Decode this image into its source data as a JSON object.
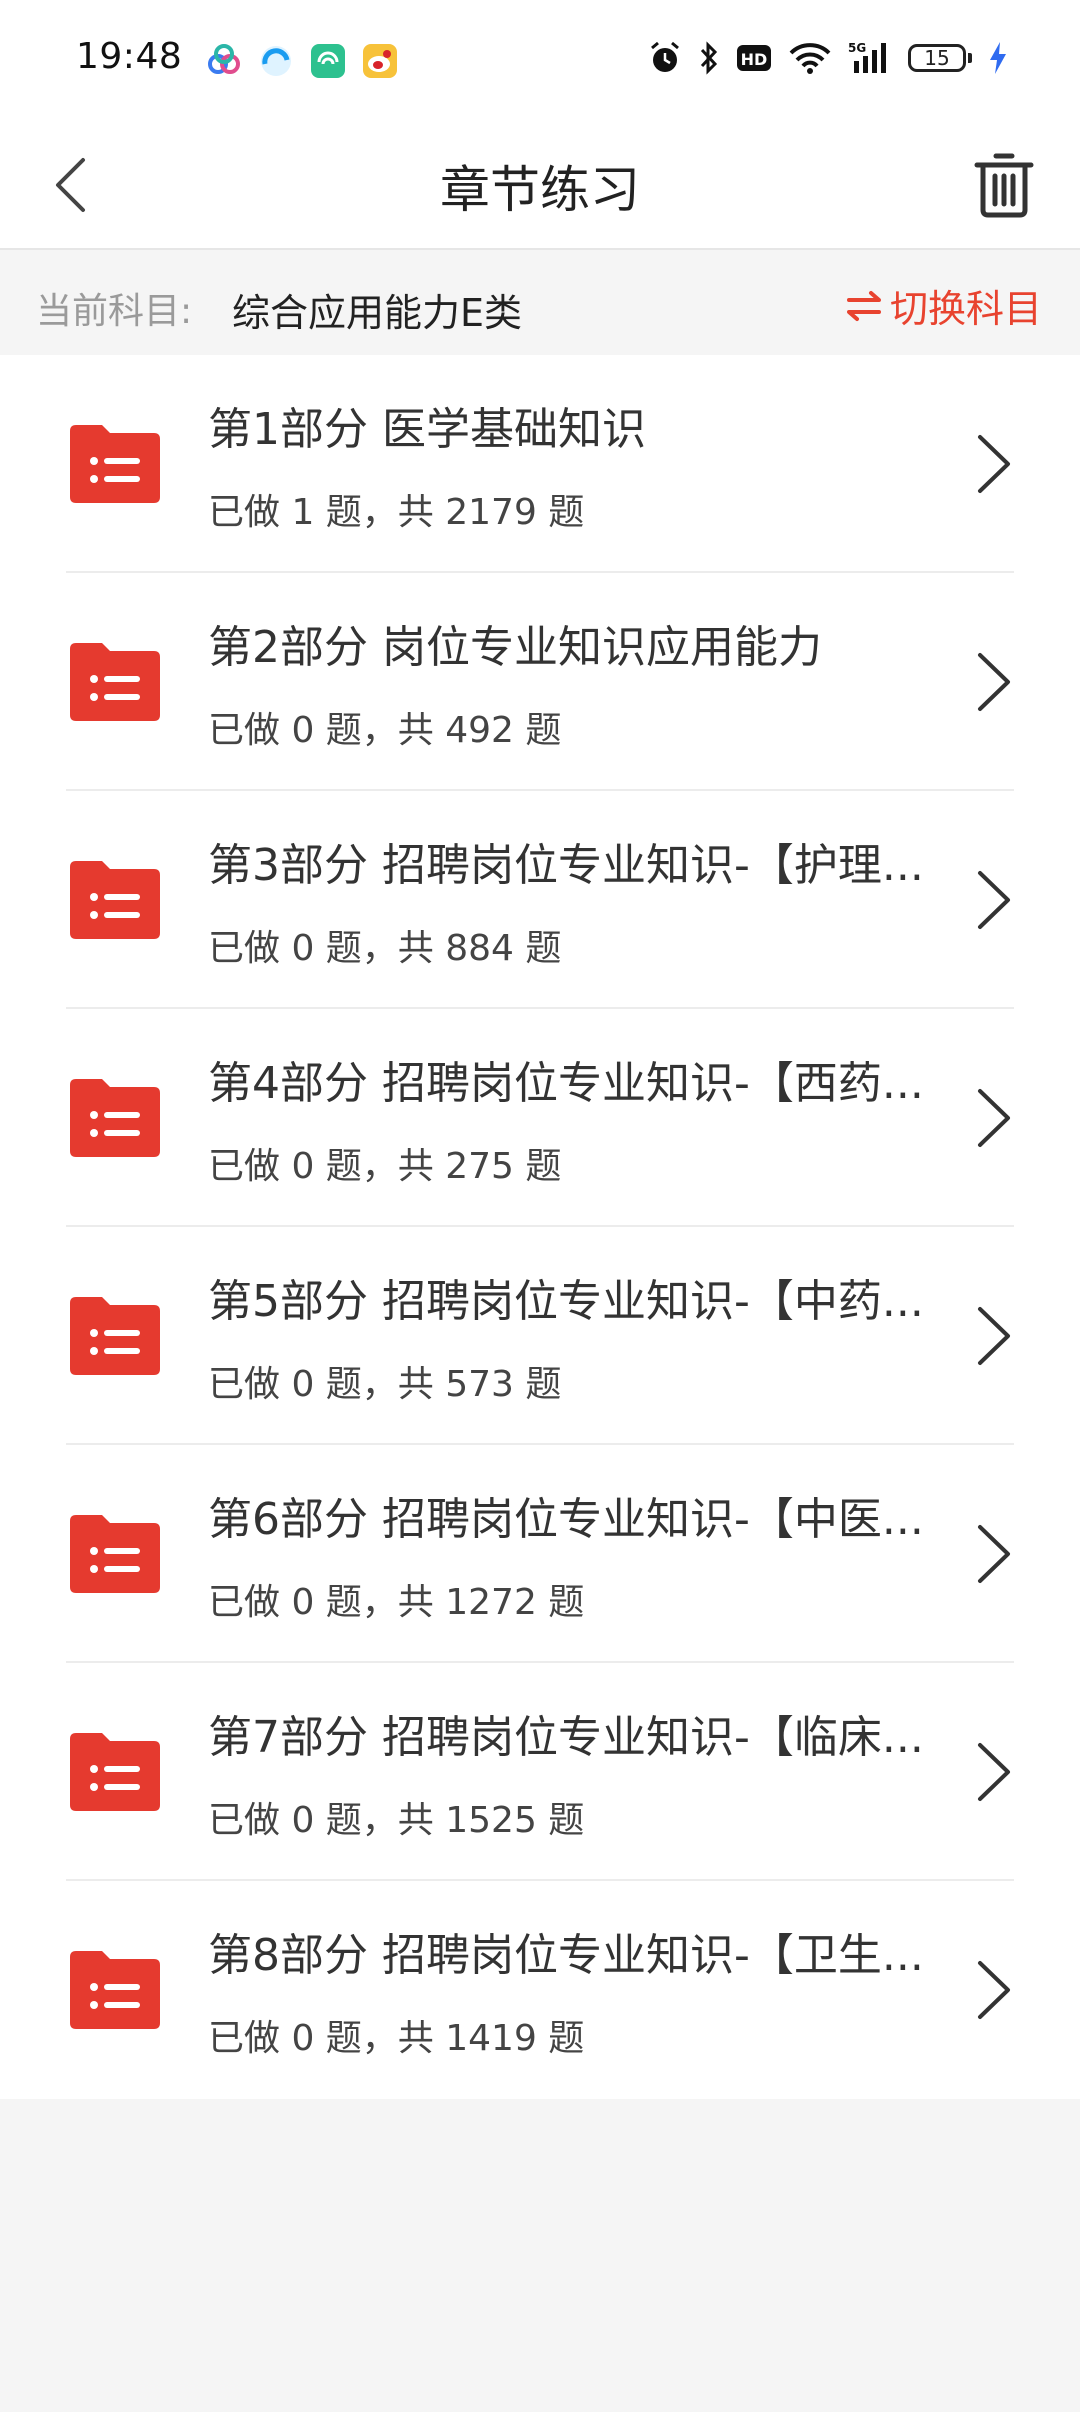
{
  "status_bar": {
    "time": "19:48",
    "battery": "15",
    "network": "5G"
  },
  "header": {
    "title": "章节练习"
  },
  "subject": {
    "label": "当前科目:",
    "value": "综合应用能力E类",
    "switch_label": "切换科目"
  },
  "colors": {
    "accent": "#e8432f",
    "folder": "#e53a2f"
  },
  "chapters": [
    {
      "title": "第1部分 医学基础知识",
      "progress": "已做 1 题，共 2179 题"
    },
    {
      "title": "第2部分 岗位专业知识应用能力",
      "progress": "已做 0 题，共 492 题"
    },
    {
      "title": "第3部分 招聘岗位专业知识-【护理...",
      "progress": "已做 0 题，共 884 题"
    },
    {
      "title": "第4部分 招聘岗位专业知识-【西药...",
      "progress": "已做 0 题，共 275 题"
    },
    {
      "title": "第5部分 招聘岗位专业知识-【中药...",
      "progress": "已做 0 题，共 573 题"
    },
    {
      "title": "第6部分 招聘岗位专业知识-【中医...",
      "progress": "已做 0 题，共 1272 题"
    },
    {
      "title": "第7部分 招聘岗位专业知识-【临床...",
      "progress": "已做 0 题，共 1525 题"
    },
    {
      "title": "第8部分 招聘岗位专业知识-【卫生...",
      "progress": "已做 0 题，共 1419 题"
    }
  ]
}
